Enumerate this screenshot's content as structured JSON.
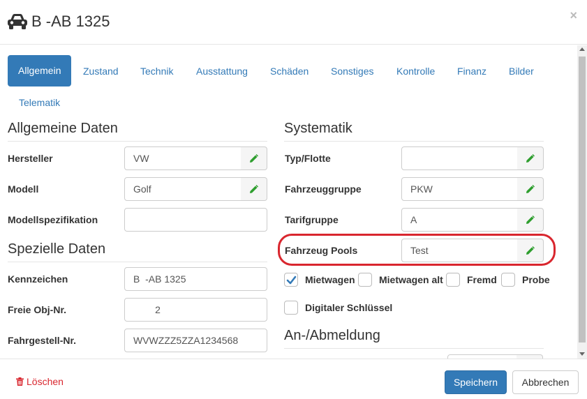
{
  "header": {
    "title": "B -AB 1325",
    "icon": "car-icon",
    "close_label": "×"
  },
  "tabs": [
    {
      "label": "Allgemein",
      "active": true
    },
    {
      "label": "Zustand"
    },
    {
      "label": "Technik"
    },
    {
      "label": "Ausstattung"
    },
    {
      "label": "Schäden"
    },
    {
      "label": "Sonstiges"
    },
    {
      "label": "Kontrolle"
    },
    {
      "label": "Finanz"
    },
    {
      "label": "Bilder"
    },
    {
      "label": "Telematik"
    }
  ],
  "left": {
    "allgemeine": {
      "title": "Allgemeine Daten",
      "fields": [
        {
          "label": "Hersteller",
          "value": "VW"
        },
        {
          "label": "Modell",
          "value": "Golf"
        },
        {
          "label": "Modellspezifikation",
          "value": ""
        }
      ]
    },
    "spezielle": {
      "title": "Spezielle Daten",
      "fields": [
        {
          "label": "Kennzeichen",
          "value": "B  -AB 1325"
        },
        {
          "label": "Freie Obj-Nr.",
          "value": "        2"
        },
        {
          "label": "Fahrgestell-Nr.",
          "value": "WVWZZZ5ZZA1234568"
        }
      ]
    }
  },
  "right": {
    "systematik": {
      "title": "Systematik",
      "fields": [
        {
          "label": "Typ/Flotte",
          "value": ""
        },
        {
          "label": "Fahrzeuggruppe",
          "value": "PKW"
        },
        {
          "label": "Tarifgruppe",
          "value": "A"
        },
        {
          "label": "Fahrzeug Pools",
          "value": "Test"
        }
      ]
    },
    "checkboxes": [
      {
        "label": "Mietwagen",
        "checked": true
      },
      {
        "label": "Mietwagen alt",
        "checked": false
      },
      {
        "label": "Fremd",
        "checked": false
      },
      {
        "label": "Probe",
        "checked": false
      },
      {
        "label": "Digitaler Schlüssel",
        "checked": false
      }
    ],
    "anmeldung": {
      "title": "An-/Abmeldung"
    }
  },
  "footer": {
    "delete_label": "Löschen",
    "save_label": "Speichern",
    "cancel_label": "Abbrechen"
  },
  "colors": {
    "primary": "#337ab7",
    "danger": "#d9262e",
    "edit_icon": "#2e9e2e"
  }
}
